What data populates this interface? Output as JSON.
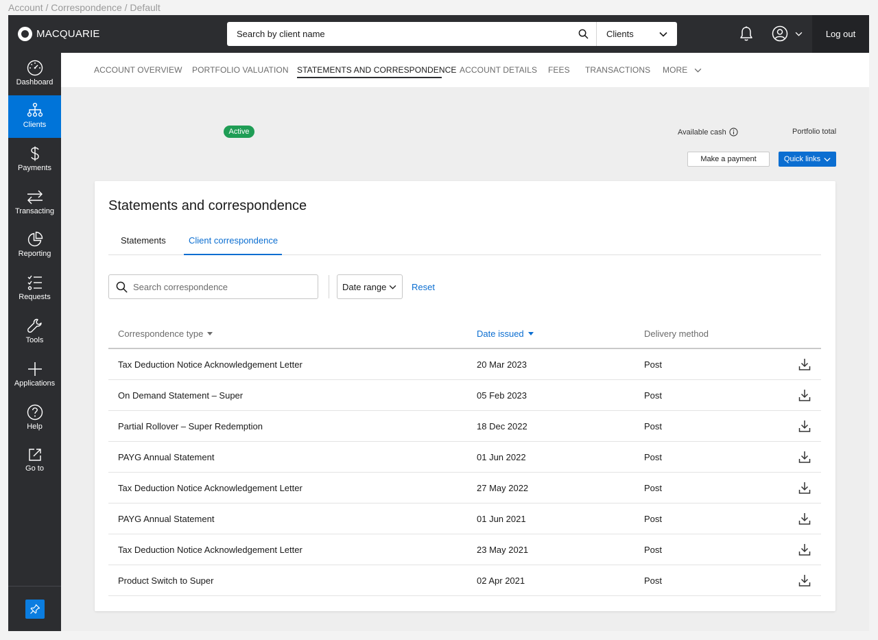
{
  "breadcrumb": "Account / Correspondence / Default",
  "header": {
    "brand": "MACQUARIE",
    "search_placeholder": "Search by client name",
    "scope_selected": "Clients",
    "logout_label": "Log out"
  },
  "sidebar": {
    "items": [
      {
        "label": "Dashboard",
        "icon": "dashboard-icon"
      },
      {
        "label": "Clients",
        "icon": "clients-hierarchy-icon",
        "active": true
      },
      {
        "label": "Payments",
        "icon": "dollar-icon"
      },
      {
        "label": "Transacting",
        "icon": "transfer-arrows-icon"
      },
      {
        "label": "Reporting",
        "icon": "pie-chart-icon"
      },
      {
        "label": "Requests",
        "icon": "checklist-icon"
      },
      {
        "label": "Tools",
        "icon": "wrench-icon"
      },
      {
        "label": "Applications",
        "icon": "plus-icon"
      },
      {
        "label": "Help",
        "icon": "help-icon"
      },
      {
        "label": "Go to",
        "icon": "external-link-icon"
      }
    ]
  },
  "account_tabs": [
    {
      "label": "ACCOUNT OVERVIEW"
    },
    {
      "label": "PORTFOLIO VALUATION"
    },
    {
      "label": "STATEMENTS AND CORRESPONDENCE",
      "active": true
    },
    {
      "label": "ACCOUNT DETAILS"
    },
    {
      "label": "FEES"
    },
    {
      "label": "TRANSACTIONS"
    },
    {
      "label": "MORE"
    }
  ],
  "account_summary": {
    "status_badge": "Active",
    "available_cash_label": "Available cash",
    "portfolio_total_label": "Portfolio total",
    "make_payment_label": "Make a payment",
    "quick_links_label": "Quick links"
  },
  "card": {
    "title": "Statements and correspondence",
    "tabs": [
      {
        "label": "Statements"
      },
      {
        "label": "Client correspondence",
        "active": true
      }
    ],
    "search_placeholder": "Search correspondence",
    "date_range_label": "Date range",
    "reset_label": "Reset",
    "columns": {
      "type": "Correspondence type",
      "date": "Date issued",
      "delivery": "Delivery method"
    },
    "rows": [
      {
        "type": "Tax Deduction Notice Acknowledgement Letter",
        "date": "20 Mar 2023",
        "delivery": "Post"
      },
      {
        "type": "On Demand Statement – Super",
        "date": "05 Feb 2023",
        "delivery": "Post"
      },
      {
        "type": "Partial Rollover – Super Redemption",
        "date": "18 Dec 2022",
        "delivery": "Post"
      },
      {
        "type": "PAYG Annual Statement",
        "date": "01 Jun 2022",
        "delivery": "Post"
      },
      {
        "type": "Tax Deduction Notice Acknowledgement Letter",
        "date": "27 May 2022",
        "delivery": "Post"
      },
      {
        "type": "PAYG Annual Statement",
        "date": "01 Jun 2021",
        "delivery": "Post"
      },
      {
        "type": "Tax Deduction Notice Acknowledgement Letter",
        "date": "23 May 2021",
        "delivery": "Post"
      },
      {
        "type": "Product Switch to Super",
        "date": "02 Apr 2021",
        "delivery": "Post"
      }
    ]
  },
  "colors": {
    "nav_dark": "#2c2d30",
    "accent_blue": "#0b6ed1",
    "active_nav": "#0074d9",
    "status_green": "#1f9d55"
  }
}
